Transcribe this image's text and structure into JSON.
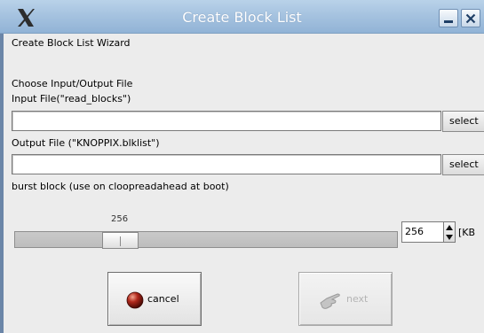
{
  "window": {
    "title": "Create Block List"
  },
  "wizard": {
    "heading": "Create Block List Wizard",
    "section": "Choose Input/Output File",
    "input_label": "Input File(\"read_blocks\")",
    "input_value": "",
    "output_label": "Output File (\"KNOPPIX.blklist\")",
    "output_value": "",
    "select_label": "select",
    "burst_label": "burst block (use on cloopreadahead at boot)"
  },
  "slider": {
    "value_label": "256",
    "value": 256
  },
  "spinner": {
    "value": "256",
    "unit": "[KB"
  },
  "buttons": {
    "cancel": "cancel",
    "next": "next"
  },
  "colors": {
    "titlebar": "#a6c3e0",
    "cancel_icon": "#b0281c",
    "background": "#ececec"
  },
  "icons": {
    "app": "x-logo-icon",
    "minimize": "minimize-icon",
    "close": "close-icon",
    "cancel": "red-ball-icon",
    "next": "hand-pointer-icon"
  }
}
